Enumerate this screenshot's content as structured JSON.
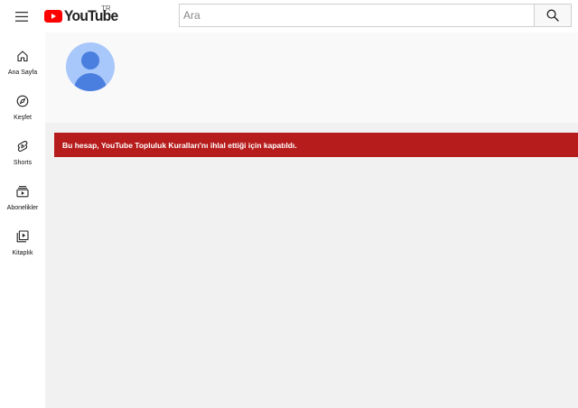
{
  "header": {
    "logo_text": "YouTube",
    "region_code": "TR",
    "search_placeholder": "Ara",
    "brand_color": "#ff0000"
  },
  "sidebar": {
    "items": [
      {
        "label": "Ana Sayfa",
        "icon": "home-icon"
      },
      {
        "label": "Keşfet",
        "icon": "compass-icon"
      },
      {
        "label": "Shorts",
        "icon": "shorts-icon"
      },
      {
        "label": "Abonelikler",
        "icon": "subscriptions-icon"
      },
      {
        "label": "Kitaplık",
        "icon": "library-icon"
      }
    ]
  },
  "channel": {
    "avatar_icon": "default-avatar-icon"
  },
  "banner": {
    "message": "Bu hesap, YouTube Topluluk Kuralları'nı ihlal ettiği için kapatıldı.",
    "color": "#b71c1c"
  }
}
